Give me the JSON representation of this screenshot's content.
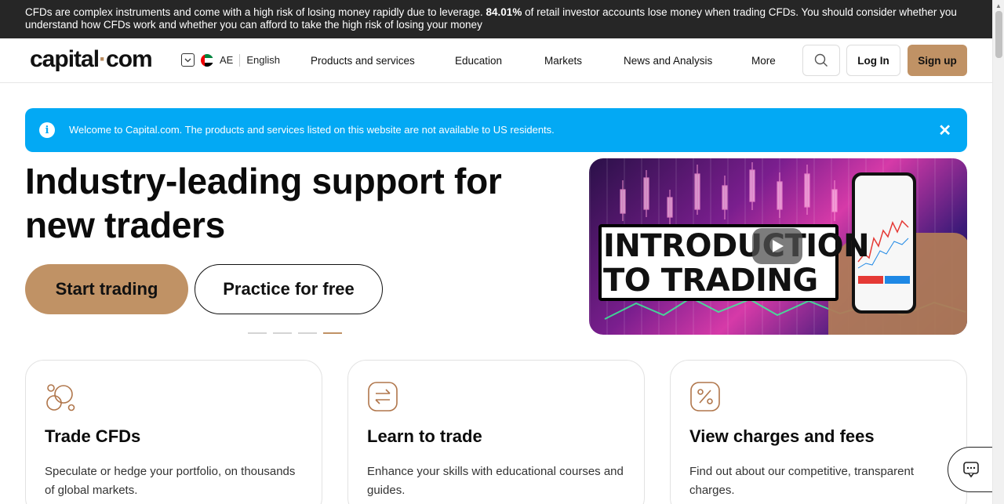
{
  "risk_banner": {
    "text_before": "CFDs are complex instruments and come with a high risk of losing money rapidly due to leverage. ",
    "percent": "84.01%",
    "text_after": " of retail investor accounts lose money when trading CFDs. You should consider whether you understand how CFDs work and whether you can afford to take the high risk of losing your money"
  },
  "header": {
    "logo_left": "capital",
    "logo_dot": "·",
    "logo_right": "com",
    "region_code": "AE",
    "language": "English",
    "nav": [
      "Products and services",
      "Education",
      "Markets",
      "News and Analysis",
      "More"
    ],
    "login_label": "Log In",
    "signup_label": "Sign up"
  },
  "notice": {
    "text": "Welcome to Capital.com. The products and services listed on this website are not available to US residents."
  },
  "hero": {
    "title": "Industry-leading support for new traders",
    "start_label": "Start trading",
    "practice_label": "Practice for free",
    "slides_total": 4,
    "active_slide": 4,
    "video_title_line1": "INTRODUCTION",
    "video_title_line2": "TO TRADING"
  },
  "cards": [
    {
      "title": "Trade CFDs",
      "desc": "Speculate or hedge your portfolio, on thousands of global markets.",
      "icon": "coins-icon"
    },
    {
      "title": "Learn to trade",
      "desc": "Enhance your skills with educational courses and guides.",
      "icon": "exchange-arrows-icon"
    },
    {
      "title": "View charges and fees",
      "desc": "Find out about our competitive, transparent charges.",
      "icon": "percent-icon"
    }
  ],
  "colors": {
    "accent": "#c09265",
    "notice_blue": "#03a9f4",
    "banner_dark": "#262626"
  }
}
